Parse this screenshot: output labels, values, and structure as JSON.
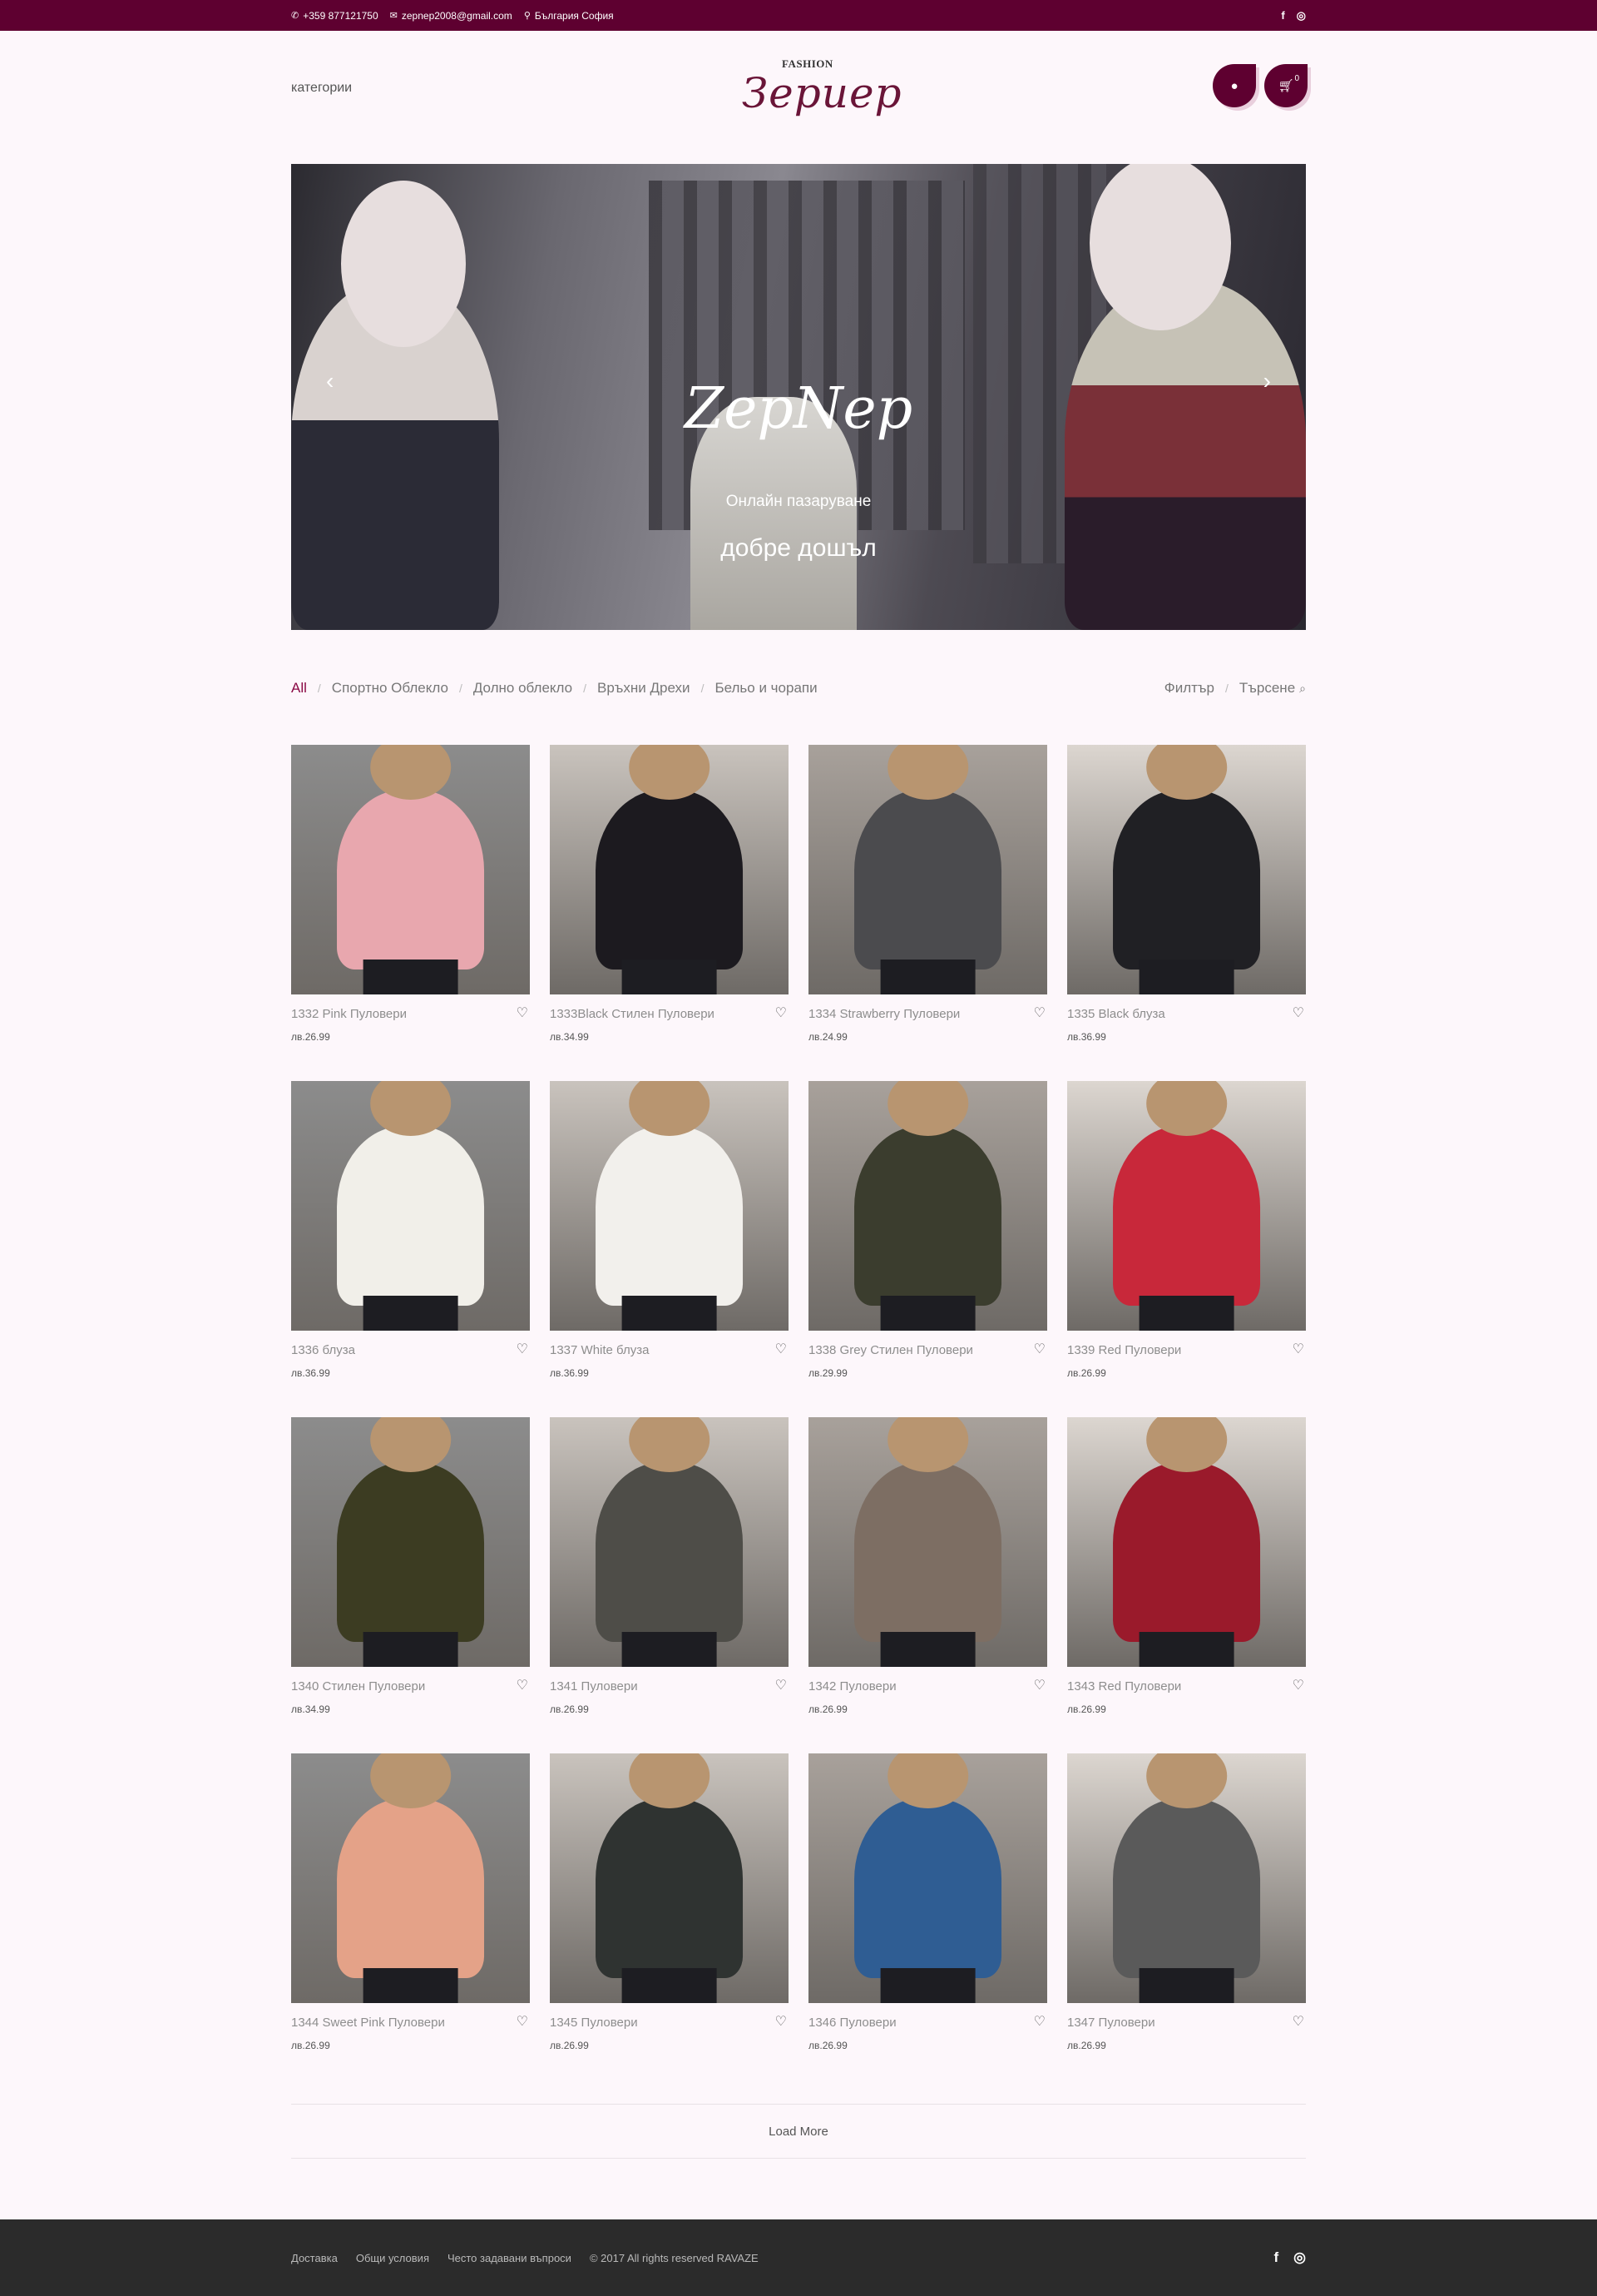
{
  "topbar": {
    "phone": "+359 877121750",
    "email": "zepnep2008@gmail.com",
    "location": "България София",
    "phone_icon": "phone-icon",
    "email_icon": "envelope-icon",
    "location_icon": "map-pin-icon"
  },
  "header": {
    "categories_label": "категории",
    "logo_small": "FASHION",
    "logo_script": "Зерuер",
    "cart_count": "0"
  },
  "hero": {
    "brand": "ZepNep",
    "subtitle": "Онлайн пазаруване",
    "welcome": "добре дошъл"
  },
  "filters": {
    "items": [
      "All",
      "Спортно Облекло",
      "Долно облекло",
      "Връхни Дрехи",
      "Бельо и чорапи"
    ],
    "filter_label": "Филтър",
    "search_label": "Търсене"
  },
  "products": [
    {
      "name": "1332 Pink Пуловери",
      "price": "лв.26.99",
      "color": "#e8a7ae"
    },
    {
      "name": "1333Black Стилен Пуловери",
      "price": "лв.34.99",
      "color": "#1c1a1f"
    },
    {
      "name": "1334 Strawberry Пуловери",
      "price": "лв.24.99",
      "color": "#4b4b4e"
    },
    {
      "name": "1335 Black блуза",
      "price": "лв.36.99",
      "color": "#202024"
    },
    {
      "name": "1336 блуза",
      "price": "лв.36.99",
      "color": "#f1efe9"
    },
    {
      "name": "1337 White блуза",
      "price": "лв.36.99",
      "color": "#f2f0ec"
    },
    {
      "name": "1338 Grey Стилен Пуловери",
      "price": "лв.29.99",
      "color": "#3b3d2e"
    },
    {
      "name": "1339 Red Пуловери",
      "price": "лв.26.99",
      "color": "#c8283a"
    },
    {
      "name": "1340 Стилен Пуловери",
      "price": "лв.34.99",
      "color": "#3c3c22"
    },
    {
      "name": "1341 Пуловери",
      "price": "лв.26.99",
      "color": "#4e4d48"
    },
    {
      "name": "1342 Пуловери",
      "price": "лв.26.99",
      "color": "#7d6e63"
    },
    {
      "name": "1343 Red Пуловери",
      "price": "лв.26.99",
      "color": "#9a1a2b"
    },
    {
      "name": "1344 Sweet Pink Пуловери",
      "price": "лв.26.99",
      "color": "#e4a288"
    },
    {
      "name": "1345 Пуловери",
      "price": "лв.26.99",
      "color": "#2f3331"
    },
    {
      "name": "1346 Пуловери",
      "price": "лв.26.99",
      "color": "#2f5d93"
    },
    {
      "name": "1347 Пуловери",
      "price": "лв.26.99",
      "color": "#5a5a5a"
    }
  ],
  "load_more": "Load More",
  "footer": {
    "links": [
      "Доставка",
      "Общи условия",
      "Често задавани въпроси",
      "© 2017 All rights reserved RAVAZE"
    ]
  },
  "colors": {
    "brand": "#5e0030",
    "accent": "#8a0a45",
    "background": "#fdf7fb",
    "footer": "#2b2b2b"
  }
}
